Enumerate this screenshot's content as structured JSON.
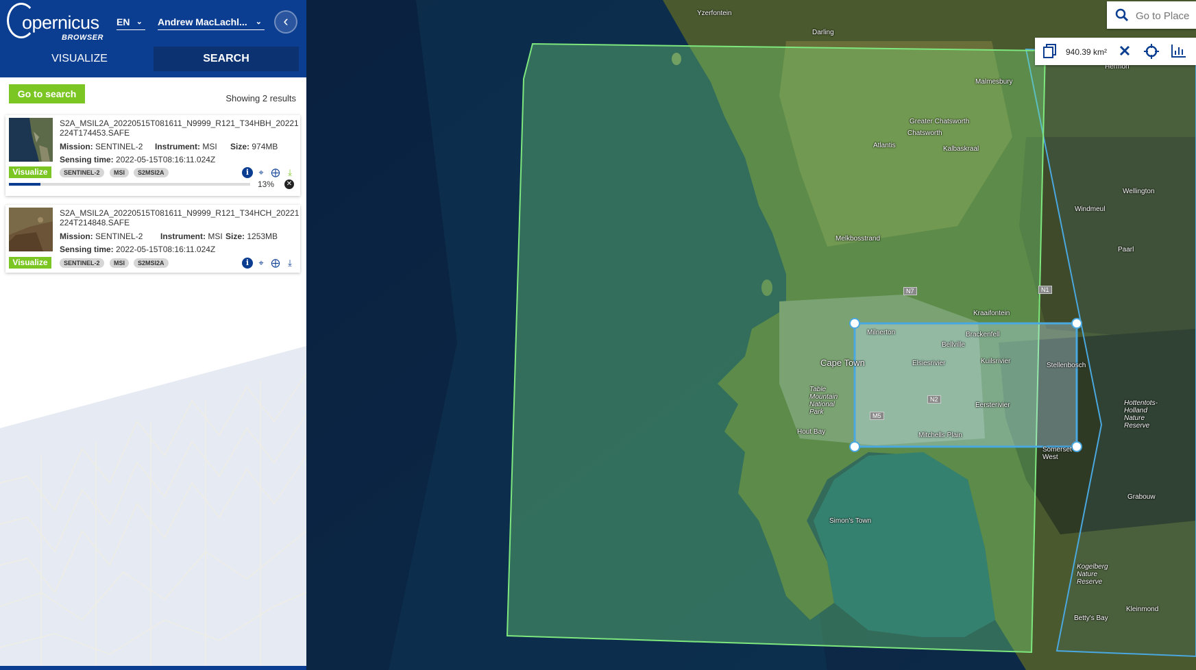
{
  "app": {
    "logo_text": "opernicus",
    "logo_sub": "BROWSER",
    "language": "EN",
    "user": "Andrew MacLachl..."
  },
  "tabs": [
    {
      "label": "VISUALIZE",
      "active": false
    },
    {
      "label": "SEARCH",
      "active": true
    }
  ],
  "results": {
    "go_to_search_label": "Go to search",
    "showing": "Showing 2 results",
    "items": [
      {
        "filename": "S2A_MSIL2A_20220515T081611_N9999_R121_T34HBH_20221224T174453.SAFE",
        "mission_label": "Mission:",
        "mission": "SENTINEL-2",
        "instrument_label": "Instrument:",
        "instrument": "MSI",
        "size_label": "Size:",
        "size": "974MB",
        "sensing_label": "Sensing time:",
        "sensing": "2022-05-15T08:16:11.024Z",
        "visualize_label": "Visualize",
        "tags": [
          "SENTINEL-2",
          "MSI",
          "S2MSI2A"
        ],
        "progress_percent": 13,
        "progress_text": "13%"
      },
      {
        "filename": "S2A_MSIL2A_20220515T081611_N9999_R121_T34HCH_20221224T214848.SAFE",
        "mission_label": "Mission:",
        "mission": "SENTINEL-2",
        "instrument_label": "Instrument:",
        "instrument": "MSI",
        "size_label": "Size:",
        "size": "1253MB",
        "sensing_label": "Sensing time:",
        "sensing": "2022-05-15T08:16:11.024Z",
        "visualize_label": "Visualize",
        "tags": [
          "SENTINEL-2",
          "MSI",
          "S2MSI2A"
        ]
      }
    ]
  },
  "map": {
    "search_placeholder": "Go to Place",
    "aoi_area": "940.39 km²",
    "labels": {
      "yzerfontein": "Yzerfontein",
      "darling": "Darling",
      "malmesbury": "Malmesbury",
      "greater_chatsworth": "Greater Chatsworth",
      "chatsworth": "Chatsworth",
      "atlantis": "Atlantis",
      "kalbaskraal": "Kalbaskraal",
      "hermon": "Hermon",
      "wellington": "Wellington",
      "windmeul": "Windmeul",
      "paarl": "Paarl",
      "melkbosstrand": "Melkbosstrand",
      "kraaifontein": "Kraaifontein",
      "milnerton": "Milnerton",
      "brackenfell": "Brackenfell",
      "bellville": "Bellville",
      "elsiesrivier": "Elsiesrivier",
      "kuilsrivier": "Kuilsrivier",
      "stellenbosch": "Stellenbosch",
      "cape_town": "Cape Town",
      "table_mountain_np": "Table Mountain National Park",
      "eersterivier": "Eersterivier",
      "hout_bay": "Hout Bay",
      "mitchells_plain": "Mitchells Plain",
      "somerset_west": "Somerset West",
      "hottentots": "Hottentots-Holland Nature Reserve",
      "simons_town": "Simon's Town",
      "grabouw": "Grabouw",
      "kogelberg": "Kogelberg Nature Reserve",
      "bettys_bay": "Betty's Bay",
      "kleinmond": "Kleinmond",
      "n7": "N7",
      "n1": "N1",
      "n2": "N2",
      "m5": "M5"
    }
  },
  "colors": {
    "brand": "#0b3d91",
    "accent_green": "#7cc624",
    "footprint": "#7ee87e",
    "aoi": "#4aa8e0"
  }
}
